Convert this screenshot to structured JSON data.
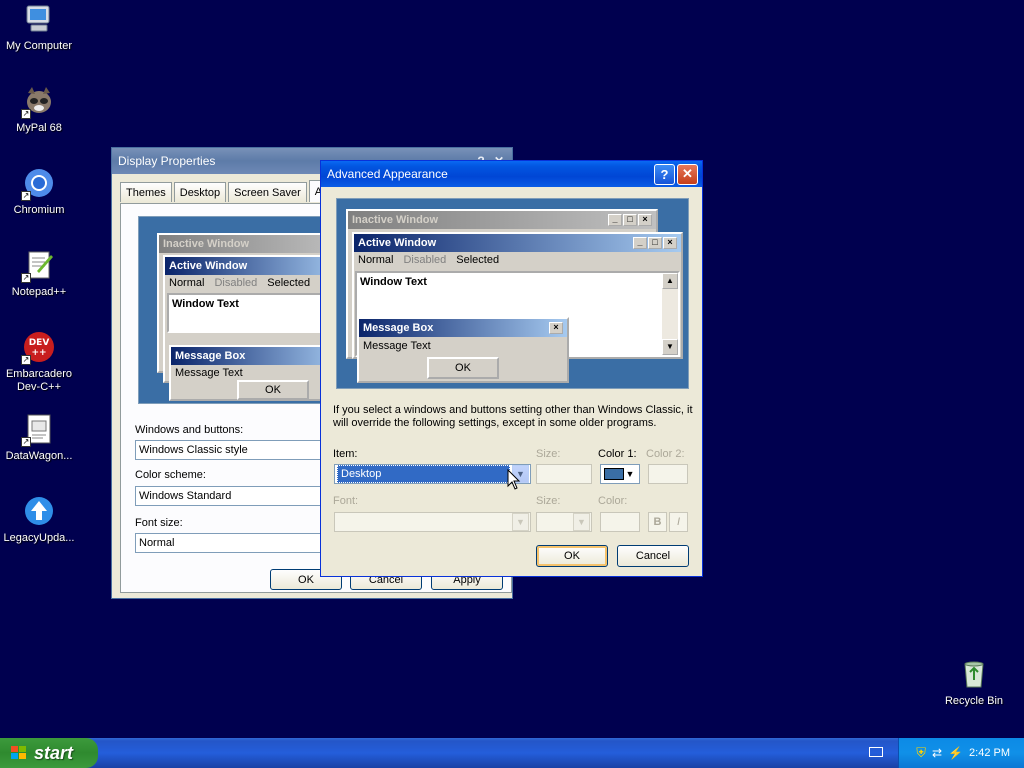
{
  "desktop": {
    "icons": [
      {
        "label": "My Computer",
        "icon": "computer-icon"
      },
      {
        "label": "MyPal 68",
        "icon": "mypal-icon"
      },
      {
        "label": "Chromium",
        "icon": "chromium-icon"
      },
      {
        "label": "Notepad++",
        "icon": "notepadpp-icon"
      },
      {
        "label": "Embarcadero Dev-C++",
        "icon": "devcpp-icon"
      },
      {
        "label": "DataWagon...",
        "icon": "datawagon-icon"
      },
      {
        "label": "LegacyUpda...",
        "icon": "legacyupdate-icon"
      },
      {
        "label": "Recycle Bin",
        "icon": "recycle-bin-icon"
      }
    ],
    "devcpp_badge": "DEV\n++",
    "background_color": "#00004f"
  },
  "display_properties": {
    "title": "Display Properties",
    "help": "?",
    "close": "✕",
    "tabs": [
      "Themes",
      "Desktop",
      "Screen Saver",
      "Ap"
    ],
    "preview": {
      "inactive_title": "Inactive Window",
      "active_title": "Active Window",
      "menu_normal": "Normal",
      "menu_disabled": "Disabled",
      "menu_selected": "Selected",
      "window_text": "Window Text",
      "message_box_title": "Message Box",
      "message_text": "Message Text",
      "ok": "OK"
    },
    "windows_and_buttons_label": "Windows and buttons:",
    "windows_and_buttons_value": "Windows Classic style",
    "color_scheme_label": "Color scheme:",
    "color_scheme_value": "Windows Standard",
    "font_size_label": "Font size:",
    "font_size_value": "Normal",
    "ok": "OK",
    "cancel": "Cancel",
    "apply": "Apply"
  },
  "advanced_appearance": {
    "title": "Advanced Appearance",
    "help": "?",
    "close": "✕",
    "preview": {
      "inactive_title": "Inactive Window",
      "active_title": "Active Window",
      "menu_normal": "Normal",
      "menu_disabled": "Disabled",
      "menu_selected": "Selected",
      "window_text": "Window Text",
      "message_box_title": "Message Box",
      "message_text": "Message Text",
      "ok": "OK"
    },
    "info_text": "If you select a windows and buttons setting other than Windows Classic, it will override the following settings, except in some older programs.",
    "item_label": "Item:",
    "item_value": "Desktop",
    "size_label": "Size:",
    "color1_label": "Color 1:",
    "color1_value": "#3a6ea5",
    "color2_label": "Color 2:",
    "font_label": "Font:",
    "font_size_label": "Size:",
    "font_color_label": "Color:",
    "bold": "B",
    "italic": "I",
    "ok": "OK",
    "cancel": "Cancel"
  },
  "taskbar": {
    "start": "start",
    "clock": "2:42 PM"
  }
}
